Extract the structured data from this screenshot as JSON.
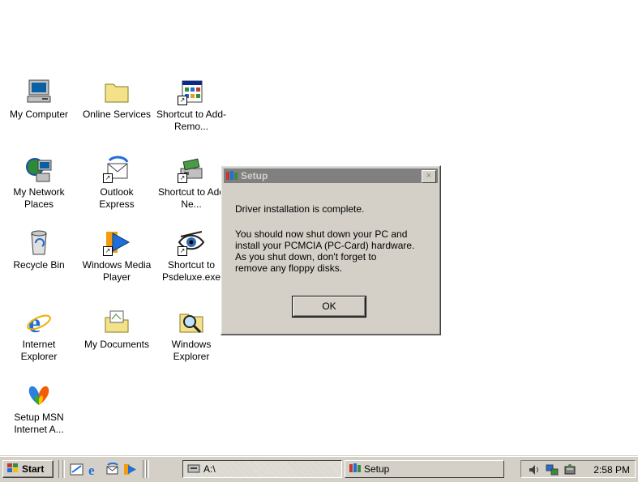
{
  "desktop": {
    "icons": [
      {
        "label": "My Computer",
        "icon": "computer-icon"
      },
      {
        "label": "Online Services",
        "icon": "folder-icon"
      },
      {
        "label": "Shortcut to Add-Remo...",
        "icon": "control-panel-icon"
      },
      {
        "label": "My Network Places",
        "icon": "network-icon"
      },
      {
        "label": "Outlook Express",
        "icon": "outlook-express-icon"
      },
      {
        "label": "Shortcut to Add Ne...",
        "icon": "add-hardware-icon"
      },
      {
        "label": "Recycle Bin",
        "icon": "recycle-bin-icon"
      },
      {
        "label": "Windows Media Player",
        "icon": "media-player-icon"
      },
      {
        "label": "Shortcut to Psdeluxe.exe",
        "icon": "eye-icon"
      },
      {
        "label": "Internet Explorer",
        "icon": "internet-explorer-icon"
      },
      {
        "label": "My Documents",
        "icon": "documents-folder-icon"
      },
      {
        "label": "Windows Explorer",
        "icon": "explorer-magnifier-icon"
      },
      {
        "label": "Setup MSN Internet A...",
        "icon": "msn-butterfly-icon"
      }
    ]
  },
  "dialog": {
    "title": "Setup",
    "close_label": "×",
    "message_line1": "Driver installation is complete.",
    "message_body": "You should now shut down your PC and\ninstall your PCMCIA (PC-Card) hardware.\nAs you shut down, don't forget to\nremove any floppy disks.",
    "ok_label": "OK"
  },
  "taskbar": {
    "start_label": "Start",
    "quick_launch": [
      "show-desktop-icon",
      "internet-explorer-icon",
      "outlook-express-icon",
      "media-player-icon"
    ],
    "tasks": [
      {
        "label": "A:\\",
        "active": true
      },
      {
        "label": "Setup",
        "active": false
      }
    ],
    "clock": "2:58 PM"
  },
  "colors": {
    "titlebar_inactive": "#808080",
    "face": "#d4d0c8",
    "desktop": "#ffffff"
  }
}
